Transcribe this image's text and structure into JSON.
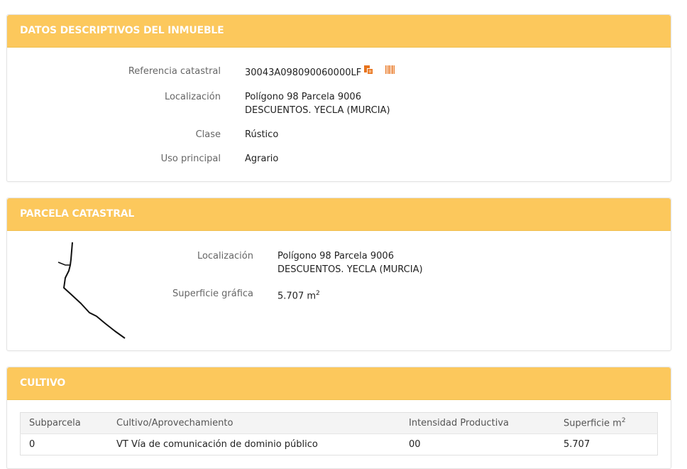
{
  "colors": {
    "header_bg": "#fcc85c",
    "header_text": "#ffffff",
    "accent_icon": "#e8731c"
  },
  "descriptive": {
    "title": "DATOS DESCRIPTIVOS DEL INMUEBLE",
    "ref_label": "Referencia catastral",
    "ref_value": "30043A098090060000LF",
    "copy_icon": "copy-icon",
    "barcode_icon": "barcode-icon",
    "loc_label": "Localización",
    "loc_line1": "Polígono 98 Parcela 9006",
    "loc_line2": "DESCUENTOS. YECLA (MURCIA)",
    "class_label": "Clase",
    "class_value": "Rústico",
    "use_label": "Uso principal",
    "use_value": "Agrario"
  },
  "parcel": {
    "title": "PARCELA CATASTRAL",
    "loc_label": "Localización",
    "loc_line1": "Polígono 98 Parcela 9006",
    "loc_line2": "DESCUENTOS. YECLA (MURCIA)",
    "area_label": "Superficie gráfica",
    "area_value": "5.707 m",
    "area_unit_sup": "2"
  },
  "crop": {
    "title": "CULTIVO",
    "headers": {
      "subparcel": "Subparcela",
      "crop": "Cultivo/Aprovechamiento",
      "intensity": "Intensidad Productiva",
      "area": "Superficie m",
      "area_sup": "2"
    },
    "rows": [
      {
        "subparcel": "0",
        "crop": "VT Vía de comunicación de dominio público",
        "intensity": "00",
        "area": "5.707"
      }
    ]
  }
}
